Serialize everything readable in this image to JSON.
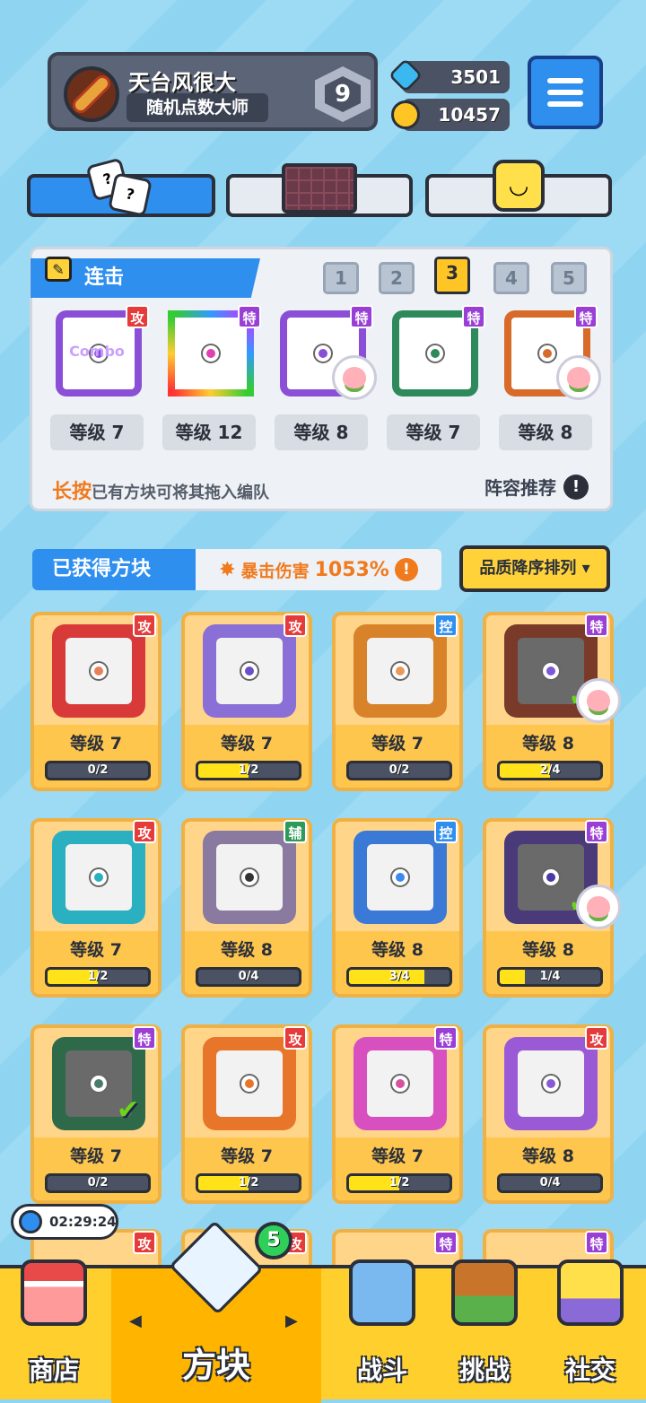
{
  "profile": {
    "name": "天台风很大",
    "title": "随机点数大师",
    "rank": "9"
  },
  "currency": {
    "gems": "3501",
    "coins": "10457"
  },
  "tabs": [
    {
      "icon": "dice-icon",
      "active": true
    },
    {
      "icon": "board-icon",
      "active": false
    },
    {
      "icon": "emoji-icon",
      "active": false
    }
  ],
  "lineup": {
    "header": "连击",
    "pages": [
      "1",
      "2",
      "3",
      "4",
      "5"
    ],
    "active_page": "3",
    "slots": [
      {
        "tag": "攻",
        "level": "等级 7",
        "color": "#8a4fd6",
        "text": "Combo"
      },
      {
        "tag": "特",
        "level": "等级 12",
        "color": "#e040b0"
      },
      {
        "tag": "特",
        "level": "等级 8",
        "color": "#8a4fd6"
      },
      {
        "tag": "特",
        "level": "等级 7",
        "color": "#2e8a5a"
      },
      {
        "tag": "特",
        "level": "等级 8",
        "color": "#d86a2a"
      }
    ],
    "hint_highlight": "长按",
    "hint_text": "已有方块可将其拖入编队",
    "recommend": "阵容推荐"
  },
  "obtained": {
    "title": "已获得方块",
    "crit_label": "暴击伤害",
    "crit_value": "1053%",
    "sort": "品质降序排列"
  },
  "cards": [
    {
      "tag": "攻",
      "tagColor": "#e53b3b",
      "frame": "#d83a3a",
      "dot": "#e8805a",
      "level": "等级 7",
      "progress": "0/2",
      "fill": 0
    },
    {
      "tag": "攻",
      "tagColor": "#e53b3b",
      "frame": "#8a6fd6",
      "dot": "#6a4fc6",
      "level": "等级 7",
      "progress": "1/2",
      "fill": 0.5
    },
    {
      "tag": "控",
      "tagColor": "#2f8fef",
      "frame": "#d8822a",
      "dot": "#e89a5a",
      "level": "等级 7",
      "progress": "0/2",
      "fill": 0
    },
    {
      "tag": "特",
      "tagColor": "#9a3fd6",
      "frame": "#7a3a2a",
      "dot": "#7a5ad6",
      "level": "等级 8",
      "progress": "2/4",
      "fill": 0.5,
      "check": true,
      "peach": true
    },
    {
      "tag": "攻",
      "tagColor": "#e53b3b",
      "frame": "#2ab0c0",
      "dot": "#2ab0c0",
      "level": "等级 7",
      "progress": "1/2",
      "fill": 0.5
    },
    {
      "tag": "辅",
      "tagColor": "#2e9a5a",
      "frame": "#8a7aa0",
      "dot": "#333333",
      "level": "等级 8",
      "progress": "0/4",
      "fill": 0
    },
    {
      "tag": "控",
      "tagColor": "#2f8fef",
      "frame": "#3a7ad6",
      "dot": "#3a8aef",
      "level": "等级 8",
      "progress": "3/4",
      "fill": 0.75
    },
    {
      "tag": "特",
      "tagColor": "#9a3fd6",
      "frame": "#4a3a7a",
      "dot": "#4a3aa6",
      "level": "等级 8",
      "progress": "1/4",
      "fill": 0.25,
      "check": true,
      "peach": true
    },
    {
      "tag": "特",
      "tagColor": "#9a3fd6",
      "frame": "#2e6a4a",
      "dot": "#4a7a6a",
      "level": "等级 7",
      "progress": "0/2",
      "fill": 0,
      "check": true
    },
    {
      "tag": "攻",
      "tagColor": "#e53b3b",
      "frame": "#e8762a",
      "dot": "#e8762a",
      "level": "等级 7",
      "progress": "1/2",
      "fill": 0.5
    },
    {
      "tag": "特",
      "tagColor": "#9a3fd6",
      "frame": "#d850c0",
      "dot": "#d850a0",
      "level": "等级 7",
      "progress": "1/2",
      "fill": 0.5
    },
    {
      "tag": "攻",
      "tagColor": "#e53b3b",
      "frame": "#9a5ad6",
      "dot": "#8a5ad6",
      "level": "等级 8",
      "progress": "0/4",
      "fill": 0
    }
  ],
  "partial_row_tags": [
    {
      "tag": "攻",
      "tagColor": "#e53b3b"
    },
    {
      "tag": "攻",
      "tagColor": "#e53b3b"
    },
    {
      "tag": "特",
      "tagColor": "#9a3fd6"
    },
    {
      "tag": "特",
      "tagColor": "#9a3fd6"
    }
  ],
  "timer": "02:29:24",
  "nav_badge": "5",
  "nav": [
    {
      "label": "商店",
      "icon": "shop-icon"
    },
    {
      "label": "方块",
      "icon": "cube-icon",
      "active": true
    },
    {
      "label": "战斗",
      "icon": "battle-icon"
    },
    {
      "label": "挑战",
      "icon": "challenge-icon"
    },
    {
      "label": "社交",
      "icon": "social-icon"
    }
  ]
}
